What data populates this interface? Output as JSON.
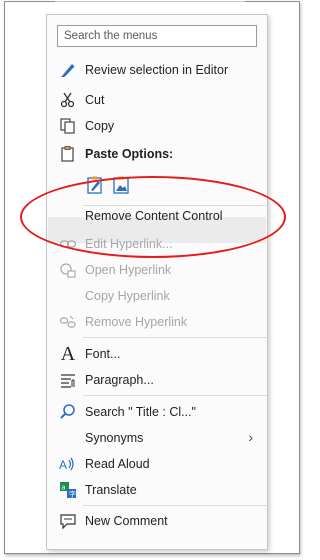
{
  "search": {
    "placeholder": "Search the menus"
  },
  "items": {
    "review": "Review selection in Editor",
    "cut": "Cut",
    "copy": "Copy",
    "paste_options": "Paste Options:",
    "remove_content_control": "Remove Content Control",
    "edit_hyperlink": "Edit Hyperlink...",
    "open_hyperlink": "Open Hyperlink",
    "copy_hyperlink": "Copy Hyperlink",
    "remove_hyperlink": "Remove Hyperlink",
    "font": "Font...",
    "paragraph": "Paragraph...",
    "search_title": "Search \"    Title : Cl...\"",
    "synonyms": "Synonyms",
    "read_aloud": "Read Aloud",
    "translate": "Translate",
    "new_comment": "New Comment"
  },
  "colors": {
    "annotation_oval": "#e31b1b",
    "disabled_text": "#a6a6a6",
    "accent_blue": "#2b6cc4"
  }
}
